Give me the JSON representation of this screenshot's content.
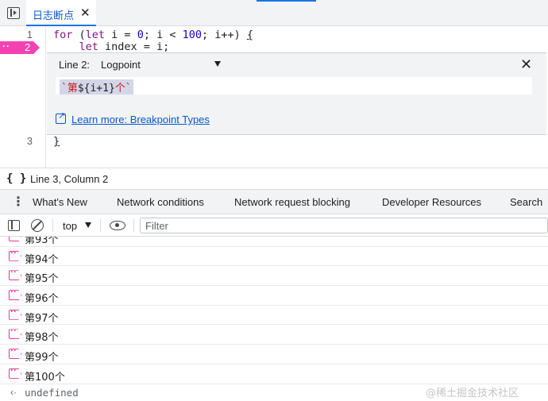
{
  "file_tab": {
    "label": "日志断点",
    "close": "✕"
  },
  "editor": {
    "line_numbers": [
      "1",
      "2",
      "3"
    ],
    "breakpoint_marker": {
      "dots": "··",
      "line": "2"
    },
    "lines": {
      "l1": {
        "kw_for": "for",
        "p1": " (",
        "kw_let": "let",
        "p2": " i = ",
        "n0": "0",
        "p3": "; i < ",
        "n100": "100",
        "p4": "; i++) ",
        "brace": "{"
      },
      "l2": {
        "indent": "    ",
        "kw_let": "let",
        "rest": " index = i;"
      },
      "l3": {
        "brace": "}"
      }
    }
  },
  "logpoint_widget": {
    "line_label": "Line 2:",
    "type_label": "Logpoint",
    "close": "✕",
    "expression": {
      "s1": "`第",
      "mid": "${i+1}",
      "s2": "个`"
    },
    "learn_more": "Learn more: Breakpoint Types"
  },
  "status_bar": {
    "icon": "{ }",
    "text": "Line 3, Column 2"
  },
  "drawer": {
    "kebab": "⋮",
    "tabs": [
      "What's New",
      "Network conditions",
      "Network request blocking",
      "Developer Resources",
      "Search"
    ]
  },
  "console_toolbar": {
    "context": "top",
    "filter_placeholder": "Filter",
    "filter_value": ""
  },
  "console": {
    "messages": [
      "第93个",
      "第94个",
      "第95个",
      "第96个",
      "第97个",
      "第98个",
      "第99个",
      "第100个"
    ],
    "result_arrow": "‹·",
    "result": "undefined",
    "watermark": "@稀土掘金技术社区"
  },
  "colors": {
    "accent": "#1a73e8",
    "logpoint": "#f442b3",
    "keyword": "#881280",
    "number": "#1c00cf",
    "string": "#c41a16",
    "link": "#0b57d0"
  },
  "icons": [
    "panel-toggle-icon",
    "close-icon",
    "logpoint-marker-icon",
    "dropdown-caret-icon",
    "external-link-icon",
    "curly-braces-icon",
    "more-vert-icon",
    "console-sidebar-icon",
    "clear-console-icon",
    "eye-icon",
    "logpoint-message-icon",
    "return-value-icon"
  ]
}
